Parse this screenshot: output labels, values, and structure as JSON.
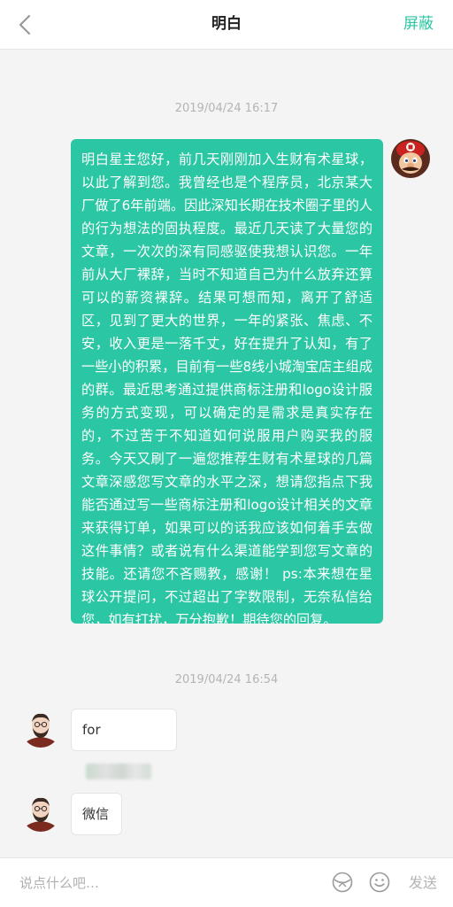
{
  "header": {
    "title": "明白",
    "block_label": "屏蔽"
  },
  "messages": [
    {
      "timestamp": "2019/04/24 16:17",
      "direction": "outgoing",
      "sender_avatar": "mario-avatar",
      "text": "明白星主您好，前几天刚刚加入生财有术星球，以此了解到您。我曾经也是个程序员，北京某大厂做了6年前端。因此深知长期在技术圈子里的人的行为想法的固执程度。最近几天读了大量您的文章，一次次的深有同感驱使我想认识您。一年前从大厂裸辞，当时不知道自己为什么放弃还算可以的薪资裸辞。结果可想而知，离开了舒适区，见到了更大的世界，一年的紧张、焦虑、不安，收入更是一落千丈，好在提升了认知，有了一些小的积累，目前有一些8线小城淘宝店主组成的群。最近思考通过提供商标注册和logo设计服务的方式变现，可以确定的是需求是真实存在的，不过苦于不知道如何说服用户购买我的服务。今天又刷了一遍您推荐生财有术星球的几篇文章深感您写文章的水平之深，想请您指点下我能否通过写一些商标注册和logo设计相关的文章来获得订单，如果可以的话我应该如何着手去做这件事情？或者说有什么渠道能学到您写文章的技能。还请您不吝赐教，感谢！ ps:本来想在星球公开提问，不过超出了字数限制，无奈私信给您，如有打扰，万分抱歉！期待您的回复。"
    },
    {
      "timestamp": "2019/04/24 16:54",
      "direction": "incoming",
      "sender_avatar": "bearded-man-avatar",
      "text": "for"
    },
    {
      "direction": "incoming",
      "sender_avatar": "bearded-man-avatar",
      "text": "微信"
    }
  ],
  "composer": {
    "placeholder": "说点什么吧…",
    "send_label": "发送",
    "icons": [
      "red-envelope-icon",
      "emoji-icon"
    ]
  },
  "colors": {
    "accent": "#2cc6a3",
    "bubble_out": "#2bc6a3",
    "background": "#f4f4f4"
  }
}
